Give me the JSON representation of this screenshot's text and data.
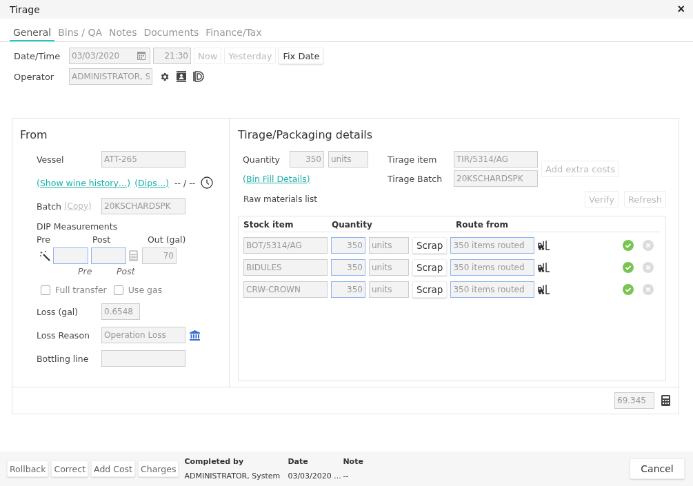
{
  "window": {
    "title": "Tirage",
    "close": "×"
  },
  "tabs": [
    {
      "label": "General",
      "selected": true
    },
    {
      "label": "Bins / QA",
      "selected": false
    },
    {
      "label": "Notes",
      "selected": false
    },
    {
      "label": "Documents",
      "selected": false
    },
    {
      "label": "Finance/Tax",
      "selected": false
    }
  ],
  "datetime": {
    "label": "Date/Time",
    "date": "03/03/2020",
    "time": "21:30",
    "buttons": [
      {
        "label": "Now",
        "disabled": true
      },
      {
        "label": "Yesterday",
        "disabled": true
      },
      {
        "label": "Fix Date",
        "disabled": false
      }
    ]
  },
  "operator": {
    "label": "Operator",
    "value": "ADMINISTRATOR, S"
  },
  "from": {
    "title": "From",
    "vessel_label": "Vessel",
    "vessel": "ATT-265",
    "links": [
      "(Show wine history…)",
      "(Dips…)"
    ],
    "dips_reading": "-- / --",
    "batch_label": "Batch",
    "copy_link": "(Copy)",
    "batch": "20KSCHARDSPK",
    "dip_title": "DIP Measurements",
    "dip_headers": [
      "Pre",
      "Post",
      "Out (gal)"
    ],
    "out_value": "70",
    "dip_captions": [
      "Pre",
      "Post"
    ],
    "checkboxes": [
      {
        "label": "Full transfer",
        "checked": false
      },
      {
        "label": "Use gas",
        "checked": false
      }
    ],
    "loss_label": "Loss (gal)",
    "loss": "0.6548",
    "loss_reason_label": "Loss Reason",
    "loss_reason": "Operation Loss",
    "bottling_label": "Bottling line"
  },
  "details": {
    "title": "Tirage/Packaging details",
    "quantity_label": "Quantity",
    "quantity": "350",
    "unit": "units",
    "bin_link": "(Bin Fill Details)",
    "tirage_item_label": "Tirage item",
    "tirage_item": "TIR/5314/AG",
    "tirage_batch_label": "Tirage Batch",
    "tirage_batch": "20KSCHARDSPK",
    "add_costs": "Add extra costs",
    "raw_label": "Raw materials list",
    "actions": [
      "Verify",
      "Refresh"
    ],
    "columns": [
      "Stock item",
      "Quantity",
      "Route from"
    ],
    "rows": [
      {
        "item": "BOT/5314/AG",
        "qty": "350",
        "unit": "units",
        "scrap": "Scrap",
        "route": "350 items routed",
        "verified": true
      },
      {
        "item": "BIDULES",
        "qty": "350",
        "unit": "units",
        "scrap": "Scrap",
        "route": "350 items routed",
        "verified": true
      },
      {
        "item": "CRW-CROWN",
        "qty": "350",
        "unit": "units",
        "scrap": "Scrap",
        "route": "350 items routed",
        "verified": true
      }
    ]
  },
  "total": "69.345",
  "footer": {
    "buttons": [
      "Rollback",
      "Correct",
      "Add Cost",
      "Charges"
    ],
    "info": [
      {
        "heading": "Completed by",
        "value": "ADMINISTRATOR, System"
      },
      {
        "heading": "Date",
        "value": "03/03/2020 ..."
      },
      {
        "heading": "Note",
        "value": "--"
      }
    ],
    "cancel": "Cancel"
  }
}
